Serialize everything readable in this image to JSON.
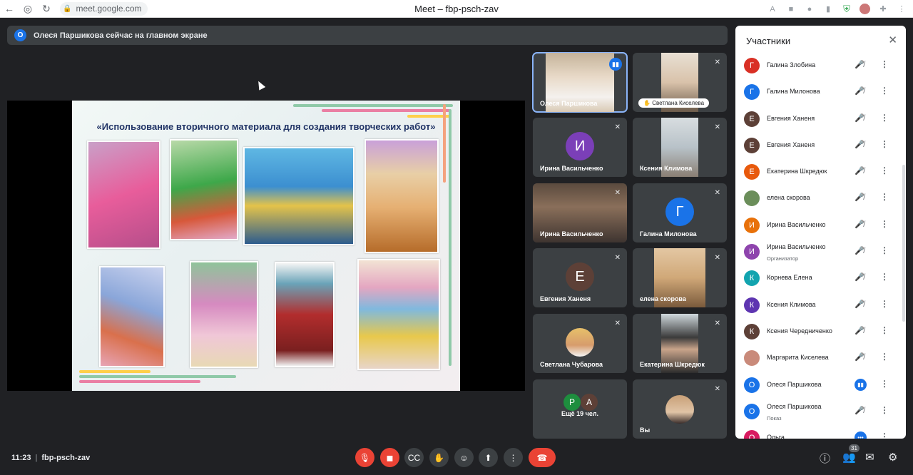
{
  "browser": {
    "url": "meet.google.com",
    "window_title": "Meet – fbp-psch-zav"
  },
  "presenter_bar": {
    "badge": "О",
    "text": "Олеся Паршикова сейчас на главном экране"
  },
  "slide": {
    "title": "«Использование вторичного материала для создания творческих работ»"
  },
  "tiles": [
    {
      "name": "Олеся Паршикова"
    },
    {
      "name": "Светлана Киселева"
    },
    {
      "name": "Ирина Васильченко",
      "initial": "И"
    },
    {
      "name": "Ксения Климова"
    },
    {
      "name": "Ирина Васильченко"
    },
    {
      "name": "Галина Милонова",
      "initial": "Г"
    },
    {
      "name": "Евгения Ханеня",
      "initial": "Е"
    },
    {
      "name": "елена скорова"
    },
    {
      "name": "Светлана Чубарова"
    },
    {
      "name": "Екатерина Шкредюк"
    },
    {
      "name": "Ещё 19 чел.",
      "initials": [
        "Р",
        "А"
      ]
    },
    {
      "name": "Вы"
    }
  ],
  "panel": {
    "title": "Участники",
    "participants": [
      {
        "initial": "Г",
        "name": "Галина Злобина",
        "color": "#d93025"
      },
      {
        "initial": "Г",
        "name": "Галина Милонова",
        "color": "#1a73e8"
      },
      {
        "initial": "Е",
        "name": "Евгения Ханеня",
        "color": "#5d4037"
      },
      {
        "initial": "Е",
        "name": "Евгения Ханеня",
        "color": "#5d4037"
      },
      {
        "initial": "Е",
        "name": "Екатерина Шкредюк",
        "color": "#e8590c"
      },
      {
        "initial": "",
        "name": "елена скорова",
        "color": "#6b8e5a"
      },
      {
        "initial": "И",
        "name": "Ирина Васильченко",
        "color": "#e8710a"
      },
      {
        "initial": "И",
        "name": "Ирина Васильченко",
        "sub": "Организатор",
        "color": "#8e44ad"
      },
      {
        "initial": "К",
        "name": "Корнева Елена",
        "color": "#12a4af"
      },
      {
        "initial": "К",
        "name": "Ксения Климова",
        "color": "#5e35b1"
      },
      {
        "initial": "К",
        "name": "Ксения Чередниченко",
        "color": "#5d4037"
      },
      {
        "initial": "",
        "name": "Маргарита Киселева",
        "color": "#c98a7a"
      },
      {
        "initial": "О",
        "name": "Олеся Паршикова",
        "color": "#1a73e8"
      },
      {
        "initial": "О",
        "name": "Олеся Паршикова",
        "sub": "Показ",
        "color": "#1a73e8"
      },
      {
        "initial": "О",
        "name": "Ольга",
        "color": "#d81b60"
      }
    ]
  },
  "bottom": {
    "time": "11:23",
    "separator": "|",
    "meeting_code": "fbp-psch-zav",
    "participant_count": "31"
  }
}
